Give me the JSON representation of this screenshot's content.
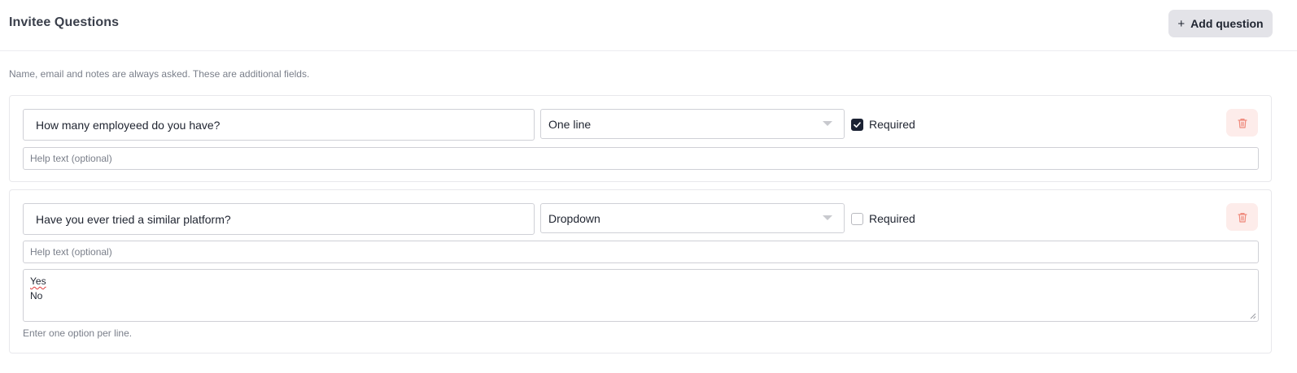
{
  "header": {
    "title": "Invitee Questions",
    "add_button_label": "Add question",
    "add_icon": "plus-icon"
  },
  "subtitle": "Name, email and notes are always asked. These are additional fields.",
  "questions": [
    {
      "text": "How many employeed do you have?",
      "type": "One line",
      "required_label": "Required",
      "required": true,
      "help_placeholder": "Help text (optional)",
      "delete_icon": "trash-icon"
    },
    {
      "text": "Have you ever tried a similar platform?",
      "type": "Dropdown",
      "required_label": "Required",
      "required": false,
      "help_placeholder": "Help text (optional)",
      "options": [
        "Yes",
        "No"
      ],
      "options_hint": "Enter one option per line.",
      "delete_icon": "trash-icon"
    }
  ],
  "colors": {
    "delete_bg": "#fdecea",
    "delete_icon": "#ef8a7c",
    "checkbox_checked": "#1b2233",
    "button_bg": "#e3e3e8"
  }
}
